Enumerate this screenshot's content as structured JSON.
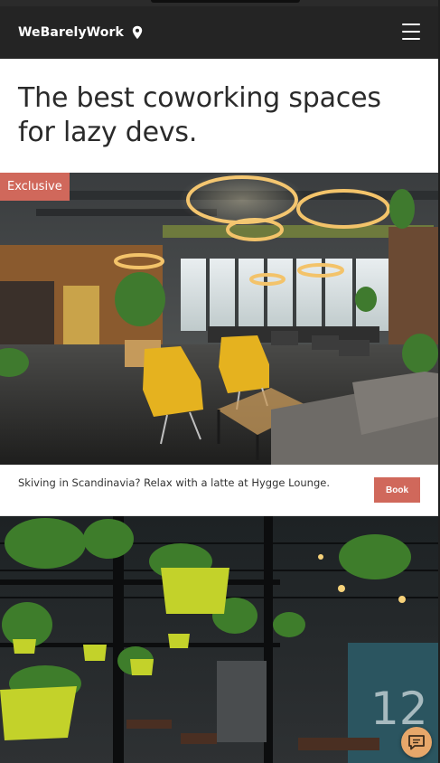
{
  "header": {
    "brand": "WeBarelyWork"
  },
  "hero": {
    "title": "The best coworking spaces for lazy devs."
  },
  "cards": [
    {
      "badge": "Exclusive",
      "caption": "Skiving in Scandinavia? Relax with a latte at Hygge Lounge.",
      "book_label": "Book"
    }
  ],
  "colors": {
    "header_bg": "#242424",
    "accent": "#d0685b",
    "chat_button": "#e7a76a"
  },
  "icons": {
    "location": "map-pin-icon",
    "menu": "hamburger-menu-icon",
    "chat": "chat-bubble-icon"
  }
}
